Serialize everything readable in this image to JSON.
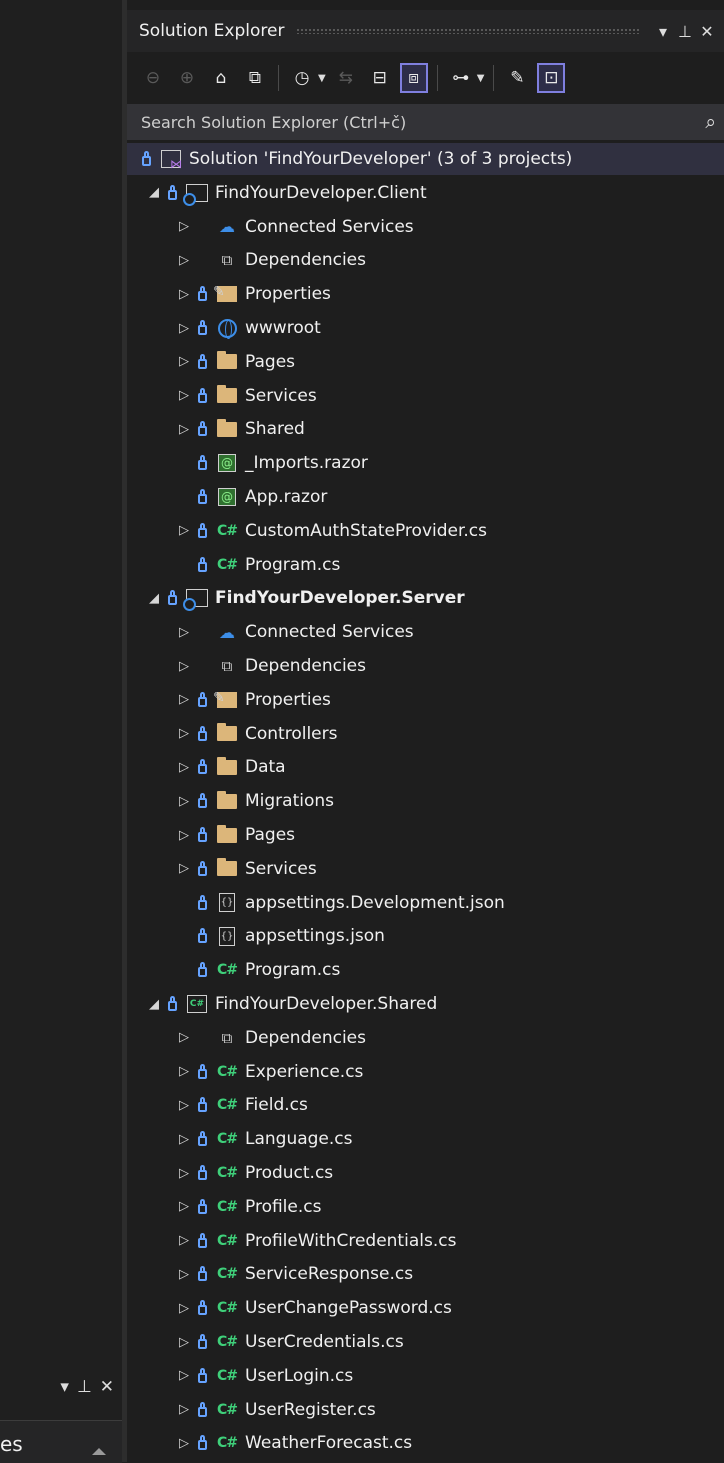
{
  "panel": {
    "title": "Solution Explorer",
    "controls": {
      "dropdown": "▾",
      "pin": "⊥",
      "close": "✕"
    }
  },
  "toolbar": {
    "back_icon": "back-icon",
    "forward_icon": "forward-icon",
    "home_icon": "home-icon",
    "switch_views_icon": "switch-views-icon",
    "pending_changes_icon": "pending-changes-icon",
    "sync_icon": "sync-icon",
    "collapse_all_icon": "collapse-all-icon",
    "show_all_files_icon": "show-all-files-icon",
    "view_class_diagram_icon": "class-diagram-icon",
    "properties_icon": "wrench-icon",
    "preview_icon": "preview-selected-icon"
  },
  "search": {
    "placeholder": "Search Solution Explorer (Ctrl+č)",
    "icon": "search-icon"
  },
  "tree": [
    {
      "label": "Solution 'FindYourDeveloper' (3 of 3 projects)",
      "indent": 0,
      "expander": "",
      "lock": true,
      "icon": "solution",
      "bold": false,
      "selected": true
    },
    {
      "label": "FindYourDeveloper.Client",
      "indent": 1,
      "expander": "open",
      "lock": true,
      "icon": "web-project",
      "bold": false
    },
    {
      "label": "Connected Services",
      "indent": 2,
      "expander": "closed",
      "lock": false,
      "icon": "cloud",
      "bold": false
    },
    {
      "label": "Dependencies",
      "indent": 2,
      "expander": "closed",
      "lock": false,
      "icon": "deps",
      "bold": false
    },
    {
      "label": "Properties",
      "indent": 2,
      "expander": "closed",
      "lock": true,
      "icon": "props",
      "bold": false
    },
    {
      "label": "wwwroot",
      "indent": 2,
      "expander": "closed",
      "lock": true,
      "icon": "globe",
      "bold": false
    },
    {
      "label": "Pages",
      "indent": 2,
      "expander": "closed",
      "lock": true,
      "icon": "folder",
      "bold": false
    },
    {
      "label": "Services",
      "indent": 2,
      "expander": "closed",
      "lock": true,
      "icon": "folder",
      "bold": false
    },
    {
      "label": "Shared",
      "indent": 2,
      "expander": "closed",
      "lock": true,
      "icon": "folder",
      "bold": false
    },
    {
      "label": "_Imports.razor",
      "indent": 2,
      "expander": "",
      "lock": true,
      "icon": "razor",
      "bold": false
    },
    {
      "label": "App.razor",
      "indent": 2,
      "expander": "",
      "lock": true,
      "icon": "razor",
      "bold": false
    },
    {
      "label": "CustomAuthStateProvider.cs",
      "indent": 2,
      "expander": "closed",
      "lock": true,
      "icon": "csharp",
      "bold": false
    },
    {
      "label": "Program.cs",
      "indent": 2,
      "expander": "",
      "lock": true,
      "icon": "csharp",
      "bold": false
    },
    {
      "label": "FindYourDeveloper.Server",
      "indent": 1,
      "expander": "open",
      "lock": true,
      "icon": "web-project",
      "bold": true
    },
    {
      "label": "Connected Services",
      "indent": 2,
      "expander": "closed",
      "lock": false,
      "icon": "cloud",
      "bold": false
    },
    {
      "label": "Dependencies",
      "indent": 2,
      "expander": "closed",
      "lock": false,
      "icon": "deps",
      "bold": false
    },
    {
      "label": "Properties",
      "indent": 2,
      "expander": "closed",
      "lock": true,
      "icon": "props",
      "bold": false
    },
    {
      "label": "Controllers",
      "indent": 2,
      "expander": "closed",
      "lock": true,
      "icon": "folder",
      "bold": false
    },
    {
      "label": "Data",
      "indent": 2,
      "expander": "closed",
      "lock": true,
      "icon": "folder",
      "bold": false
    },
    {
      "label": "Migrations",
      "indent": 2,
      "expander": "closed",
      "lock": true,
      "icon": "folder",
      "bold": false
    },
    {
      "label": "Pages",
      "indent": 2,
      "expander": "closed",
      "lock": true,
      "icon": "folder",
      "bold": false
    },
    {
      "label": "Services",
      "indent": 2,
      "expander": "closed",
      "lock": true,
      "icon": "folder",
      "bold": false
    },
    {
      "label": "appsettings.Development.json",
      "indent": 2,
      "expander": "",
      "lock": true,
      "icon": "json",
      "bold": false
    },
    {
      "label": "appsettings.json",
      "indent": 2,
      "expander": "",
      "lock": true,
      "icon": "json",
      "bold": false
    },
    {
      "label": "Program.cs",
      "indent": 2,
      "expander": "",
      "lock": true,
      "icon": "csharp",
      "bold": false
    },
    {
      "label": "FindYourDeveloper.Shared",
      "indent": 1,
      "expander": "open",
      "lock": true,
      "icon": "cs-project",
      "bold": false
    },
    {
      "label": "Dependencies",
      "indent": 2,
      "expander": "closed",
      "lock": false,
      "icon": "deps",
      "bold": false
    },
    {
      "label": "Experience.cs",
      "indent": 2,
      "expander": "closed",
      "lock": true,
      "icon": "csharp",
      "bold": false
    },
    {
      "label": "Field.cs",
      "indent": 2,
      "expander": "closed",
      "lock": true,
      "icon": "csharp",
      "bold": false
    },
    {
      "label": "Language.cs",
      "indent": 2,
      "expander": "closed",
      "lock": true,
      "icon": "csharp",
      "bold": false
    },
    {
      "label": "Product.cs",
      "indent": 2,
      "expander": "closed",
      "lock": true,
      "icon": "csharp",
      "bold": false
    },
    {
      "label": "Profile.cs",
      "indent": 2,
      "expander": "closed",
      "lock": true,
      "icon": "csharp",
      "bold": false
    },
    {
      "label": "ProfileWithCredentials.cs",
      "indent": 2,
      "expander": "closed",
      "lock": true,
      "icon": "csharp",
      "bold": false
    },
    {
      "label": "ServiceResponse.cs",
      "indent": 2,
      "expander": "closed",
      "lock": true,
      "icon": "csharp",
      "bold": false
    },
    {
      "label": "UserChangePassword.cs",
      "indent": 2,
      "expander": "closed",
      "lock": true,
      "icon": "csharp",
      "bold": false
    },
    {
      "label": "UserCredentials.cs",
      "indent": 2,
      "expander": "closed",
      "lock": true,
      "icon": "csharp",
      "bold": false
    },
    {
      "label": "UserLogin.cs",
      "indent": 2,
      "expander": "closed",
      "lock": true,
      "icon": "csharp",
      "bold": false
    },
    {
      "label": "UserRegister.cs",
      "indent": 2,
      "expander": "closed",
      "lock": true,
      "icon": "csharp",
      "bold": false
    },
    {
      "label": "WeatherForecast.cs",
      "indent": 2,
      "expander": "closed",
      "lock": true,
      "icon": "csharp",
      "bold": false
    }
  ],
  "left_panel": {
    "tab_text": "es",
    "controls": {
      "dropdown": "▾",
      "pin": "⊥",
      "close": "✕"
    }
  }
}
